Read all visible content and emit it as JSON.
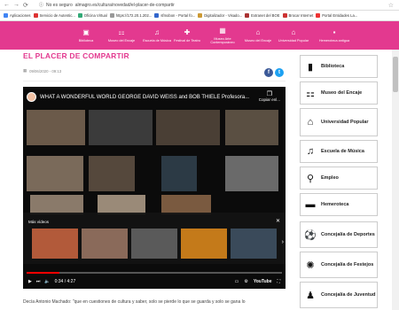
{
  "browser": {
    "url_security": "No es seguro",
    "url": "almagro.es/cultura/novedad/el-placer-de-compartir",
    "bookmarks": [
      "Aplicaciones",
      "Servicio de Autentic...",
      "Oficina Virtual",
      "https://172.20.1.202...",
      "sfmobon - Portal fo...",
      "Digitalizador - Visado...",
      "Extranet del BOE",
      "Brocar Internet",
      "Portal Entidades La..."
    ]
  },
  "sitenav": {
    "items": [
      {
        "icon": "▣",
        "label": "Biblioteca"
      },
      {
        "icon": "⚏",
        "label": "Museo del Encaje"
      },
      {
        "icon": "♫",
        "label": "Escuela de Música"
      },
      {
        "icon": "✚",
        "label": "Festival de Teatro"
      },
      {
        "icon": "▦",
        "label": "Museo Arte Contemporáneo"
      },
      {
        "icon": "⌂",
        "label": "Museo del Encaje"
      },
      {
        "icon": "⌂",
        "label": "Universidad Popular"
      },
      {
        "icon": "▪",
        "label": "Hemeroteca antigua"
      }
    ]
  },
  "article": {
    "title": "EL PLACER DE COMPARTIR",
    "date": "09/06/2020 - 09:13",
    "body": "Decía Antonio Machado: \"que en cuestiones de cultura y saber, solo se pierde lo que se guarda y solo se gana lo"
  },
  "video": {
    "title": "WHAT A WONDERFUL WORLD GEORGE DAVID WEISS and BOB THIELE Profesora...",
    "copy_link": "Copiar enl...",
    "more_videos": "Más vídeos",
    "time": "0:34 / 4:27",
    "progress": 0.13,
    "youtube": "YouTube"
  },
  "sidebar": {
    "items": [
      {
        "icon": "▮",
        "label": "Biblioteca"
      },
      {
        "icon": "⚏",
        "label": "Museo del Encaje"
      },
      {
        "icon": "⌂",
        "label": "Universidad Popular"
      },
      {
        "icon": "♫",
        "label": "Escuela de Música"
      },
      {
        "icon": "⚲",
        "label": "Empleo"
      },
      {
        "icon": "▬",
        "label": "Hemeroteca"
      },
      {
        "icon": "⚽",
        "label": "Concejalía de Deportes"
      },
      {
        "icon": "✺",
        "label": "Concejalía de Festejos"
      },
      {
        "icon": "♟",
        "label": "Concejalía de Juventud"
      }
    ]
  }
}
